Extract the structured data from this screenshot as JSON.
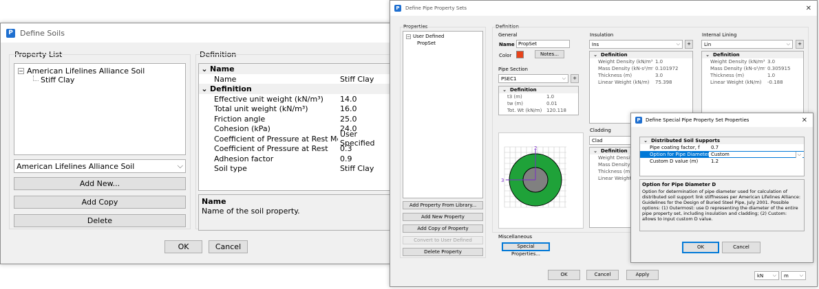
{
  "soils": {
    "title": "Define Soils",
    "property_list_label": "Property List",
    "definition_label": "Definition",
    "tree_root": "American Lifelines Alliance Soil",
    "tree_child": "Stiff Clay",
    "combo_value": "American Lifelines Alliance Soil",
    "add_new": "Add New...",
    "add_copy": "Add Copy",
    "delete": "Delete",
    "grid": {
      "name_section": "Name",
      "name_key": "Name",
      "name_value": "Stiff Clay",
      "def_section": "Definition",
      "rows": [
        {
          "k": "Effective unit weight (kN/m³)",
          "v": "14.0"
        },
        {
          "k": "Total unit weight (kN/m³)",
          "v": "16.0"
        },
        {
          "k": "Friction angle",
          "v": "25.0"
        },
        {
          "k": "Cohesion (kPa)",
          "v": "24.0"
        },
        {
          "k": "Coefficient of Pressure at Rest Method",
          "v": "User Specified"
        },
        {
          "k": "Coefficient of Pressure at Rest",
          "v": "0.3"
        },
        {
          "k": "Adhesion factor",
          "v": "0.9"
        },
        {
          "k": "Soil type",
          "v": "Stiff Clay"
        }
      ]
    },
    "desc_title": "Name",
    "desc_text": "Name of the soil property.",
    "ok": "OK",
    "cancel": "Cancel"
  },
  "pipe": {
    "title": "Define Pipe Property Sets",
    "properties_label": "Properties",
    "tree_root": "User Defined",
    "tree_child": "PropSet",
    "btn_from_library": "Add Property From Library...",
    "btn_add_new": "Add New Property",
    "btn_add_copy": "Add Copy of Property",
    "btn_convert": "Convert to User Defined",
    "btn_delete": "Delete Property",
    "definition_label": "Definition",
    "general_label": "General",
    "name_label": "Name",
    "name_value": "PropSet",
    "color_label": "Color",
    "color_value": "#e8431a",
    "notes": "Notes...",
    "pipe_section_label": "Pipe Section",
    "pipe_section_value": "PSEC1",
    "plus": "+",
    "section_def": "Definition",
    "section_rows": [
      {
        "k": "t3 (m)",
        "v": "1.0"
      },
      {
        "k": "tw (m)",
        "v": "0.01"
      },
      {
        "k": "Tot. Wt (kN/m)",
        "v": "120.118"
      }
    ],
    "insulation_label": "Insulation",
    "insulation_value": "Ins",
    "insulation_rows": [
      {
        "k": "Weight Density (kN/m³)",
        "v": "1.0"
      },
      {
        "k": "Mass Density (kN-s²/m⁴)",
        "v": "0.101972"
      },
      {
        "k": "Thickness (m)",
        "v": "3.0"
      },
      {
        "k": "Linear Weight (kN/m)",
        "v": "75.398"
      }
    ],
    "lining_label": "Internal Lining",
    "lining_value": "Lin",
    "lining_rows": [
      {
        "k": "Weight Density (kN/m³)",
        "v": "3.0"
      },
      {
        "k": "Mass Density (kN-s²/m⁴)",
        "v": "0.305915"
      },
      {
        "k": "Thickness (m)",
        "v": "1.0"
      },
      {
        "k": "Linear Weight (kN/m)",
        "v": "-0.188"
      }
    ],
    "cladding_label": "Cladding",
    "cladding_value": "Clad",
    "cladding_rows": [
      {
        "k": "Weight Density (k",
        "v": ""
      },
      {
        "k": "Mass Density (k",
        "v": ""
      },
      {
        "k": "Thickness (m)",
        "v": ""
      },
      {
        "k": "Linear Weight (k",
        "v": ""
      }
    ],
    "axis_2": "2",
    "axis_3": "3",
    "misc_label": "Miscellaneous",
    "special_props": "Special Properties...",
    "ok": "OK",
    "cancel": "Cancel",
    "apply": "Apply",
    "unit_force": "kN",
    "unit_length": "m"
  },
  "special": {
    "title": "Define Special Pipe Property Set Properties",
    "section": "Distributed Soil Supports",
    "rows": [
      {
        "k": "Pipe coating factor, f",
        "v": "0.7"
      },
      {
        "k": "Option for Pipe Diameter D",
        "v": "Custom"
      },
      {
        "k": "Custom D value (m)",
        "v": "1.2"
      }
    ],
    "desc_title": "Option for Pipe Diameter D",
    "desc_text": "Option for determination of pipe diameter used for calculation of distributed soil support link stiffnesses per American Lifelines Alliance: Guidelines for the Design of Buried Steel Pipe, July 2001. Possible options: (1) Outermost: use D representing the diameter of the entire pipe property set, including insulation and cladding; (2) Custom: allows to input custom D value.",
    "ok": "OK",
    "cancel": "Cancel"
  }
}
